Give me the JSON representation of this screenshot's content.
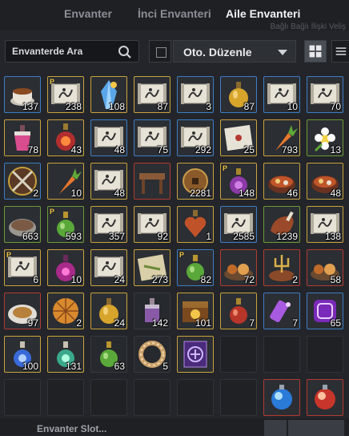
{
  "tabs": [
    {
      "label": "Envanter",
      "active": false
    },
    {
      "label": "İnci Envanteri",
      "active": false
    },
    {
      "label": "Aile Envanteri",
      "active": true
    }
  ],
  "ghost_text": "Bağlı Bağlı İlişki Veliş",
  "search": {
    "placeholder": "Envanterde Ara",
    "icon": "search-icon"
  },
  "sort": {
    "label": "Oto. Düzenle",
    "icon": "chevron-down-icon"
  },
  "view": {
    "grid_icon": "grid-view-icon",
    "list_icon": "list-view-icon"
  },
  "footer": {
    "label": "Envanter Slot..."
  },
  "colors": {
    "blue": "#3c7dc4",
    "gold": "#c9a23c",
    "green": "#6c9a35",
    "red": "#b23b31"
  },
  "slots": [
    {
      "icon": "tea-cup",
      "border": "blue",
      "qty": "137"
    },
    {
      "icon": "scroll",
      "border": "gold",
      "qty": "238",
      "p": true
    },
    {
      "icon": "crystal",
      "border": "gold",
      "qty": "108"
    },
    {
      "icon": "scroll",
      "border": "gold",
      "qty": "87"
    },
    {
      "icon": "scroll",
      "border": "blue",
      "qty": "3"
    },
    {
      "icon": "potion-gold",
      "border": "blue",
      "qty": "87"
    },
    {
      "icon": "scroll",
      "border": "blue",
      "qty": "10"
    },
    {
      "icon": "scroll",
      "border": "blue",
      "qty": "70"
    },
    {
      "icon": "potion-pink",
      "border": "gold",
      "qty": "78"
    },
    {
      "icon": "elixir-red",
      "border": "gold",
      "qty": "43"
    },
    {
      "icon": "scroll",
      "border": "blue",
      "qty": "48"
    },
    {
      "icon": "scroll",
      "border": "blue",
      "qty": "75"
    },
    {
      "icon": "scroll",
      "border": "blue",
      "qty": "292"
    },
    {
      "icon": "letter",
      "border": "gold",
      "qty": "25"
    },
    {
      "icon": "carrot",
      "border": "gold",
      "qty": "793"
    },
    {
      "icon": "flower",
      "border": "green",
      "qty": "13"
    },
    {
      "icon": "crossed-swords",
      "border": "blue",
      "qty": "2"
    },
    {
      "icon": "carrot",
      "border": "gold",
      "qty": "10"
    },
    {
      "icon": "scroll",
      "border": "gold",
      "qty": "48"
    },
    {
      "icon": "table",
      "border": "red",
      "qty": ""
    },
    {
      "icon": "coin",
      "border": "gold",
      "qty": "2281"
    },
    {
      "icon": "potion-purple",
      "border": "gold",
      "qty": "148",
      "p": true
    },
    {
      "icon": "stew",
      "border": "gold",
      "qty": "46"
    },
    {
      "icon": "stew",
      "border": "gold",
      "qty": "48"
    },
    {
      "icon": "bowl",
      "border": "green",
      "qty": "663"
    },
    {
      "icon": "potion-green",
      "border": "green",
      "qty": "593",
      "p": true
    },
    {
      "icon": "scroll",
      "border": "gold",
      "qty": "357"
    },
    {
      "icon": "scroll",
      "border": "gold",
      "qty": "92"
    },
    {
      "icon": "heart-potion",
      "border": "gold",
      "qty": "1"
    },
    {
      "icon": "scroll",
      "border": "blue",
      "qty": "2585"
    },
    {
      "icon": "meat",
      "border": "green",
      "qty": "1239"
    },
    {
      "icon": "scroll",
      "border": "gold",
      "qty": "138"
    },
    {
      "icon": "scroll",
      "border": "gold",
      "qty": "6",
      "p": true
    },
    {
      "icon": "potion-magenta",
      "border": "gold",
      "qty": "10"
    },
    {
      "icon": "scroll",
      "border": "gold",
      "qty": "24"
    },
    {
      "icon": "map",
      "border": "gold",
      "qty": "273"
    },
    {
      "icon": "potion-green",
      "border": "blue",
      "qty": "82",
      "p": true
    },
    {
      "icon": "feast",
      "border": "red",
      "qty": "72"
    },
    {
      "icon": "trident",
      "border": "red",
      "qty": "2"
    },
    {
      "icon": "feast",
      "border": "red",
      "qty": "58"
    },
    {
      "icon": "plate",
      "border": "red",
      "qty": "97"
    },
    {
      "icon": "pie",
      "border": "gold",
      "qty": "2"
    },
    {
      "icon": "potion-gold",
      "border": "gold",
      "qty": "24"
    },
    {
      "icon": "potion-violet",
      "border": "none",
      "qty": "142"
    },
    {
      "icon": "chest",
      "border": "gold",
      "qty": "101"
    },
    {
      "icon": "potion-red",
      "border": "gold",
      "qty": "7"
    },
    {
      "icon": "vial-purple",
      "border": "blue",
      "qty": "7"
    },
    {
      "icon": "badge",
      "border": "blue",
      "qty": "65"
    },
    {
      "icon": "potion-blue",
      "border": "gold",
      "qty": "100"
    },
    {
      "icon": "potion-teal",
      "border": "gold",
      "qty": "131"
    },
    {
      "icon": "potion-green",
      "border": "none",
      "qty": "63"
    },
    {
      "icon": "ring",
      "border": "none",
      "qty": "5"
    },
    {
      "icon": "rune",
      "border": "gold",
      "qty": ""
    },
    {
      "icon": "",
      "border": "dark",
      "qty": ""
    },
    {
      "icon": "",
      "border": "dark",
      "qty": ""
    },
    {
      "icon": "",
      "border": "dark",
      "qty": ""
    },
    {
      "icon": "",
      "border": "dark",
      "qty": ""
    },
    {
      "icon": "",
      "border": "dark",
      "qty": ""
    },
    {
      "icon": "",
      "border": "dark",
      "qty": ""
    },
    {
      "icon": "",
      "border": "dark",
      "qty": ""
    },
    {
      "icon": "",
      "border": "dark",
      "qty": ""
    },
    {
      "icon": "",
      "border": "dark",
      "qty": ""
    },
    {
      "icon": "orb-blue",
      "border": "red",
      "qty": ""
    },
    {
      "icon": "orb-red",
      "border": "red",
      "qty": ""
    }
  ]
}
